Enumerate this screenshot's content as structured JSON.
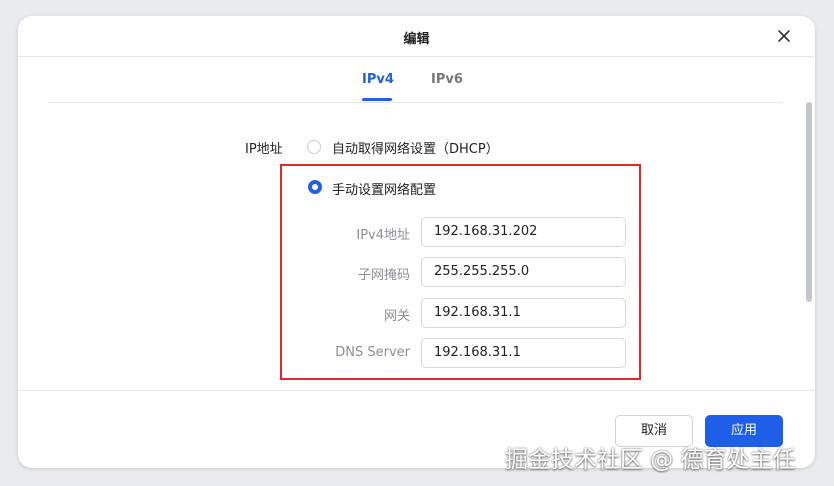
{
  "dialog": {
    "title": "编辑"
  },
  "tabs": [
    {
      "label": "IPv4",
      "active": true
    },
    {
      "label": "IPv6",
      "active": false
    }
  ],
  "ip_section": {
    "label": "IP地址",
    "options": [
      {
        "label": "自动取得网络设置（DHCP）",
        "selected": false
      },
      {
        "label": "手动设置网络配置",
        "selected": true
      }
    ]
  },
  "manual_fields": [
    {
      "label": "IPv4地址",
      "value": "192.168.31.202"
    },
    {
      "label": "子网掩码",
      "value": "255.255.255.0"
    },
    {
      "label": "网关",
      "value": "192.168.31.1"
    },
    {
      "label": "DNS Server",
      "value": "192.168.31.1"
    }
  ],
  "footer": {
    "cancel_label": "取消",
    "apply_label": "应用"
  },
  "watermark": "掘金技术社区 @ 德育处主任",
  "colors": {
    "accent": "#2460e0",
    "highlight_border": "#e0282e",
    "primary_button": "#1f5ee8"
  },
  "icons": {
    "close": "close-icon"
  }
}
